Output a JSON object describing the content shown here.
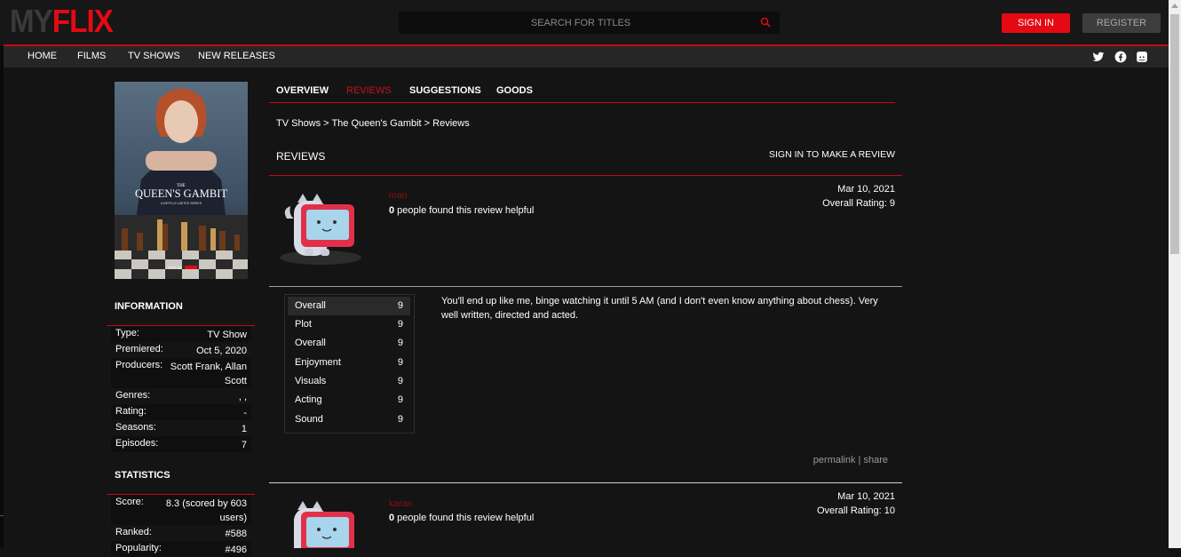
{
  "header": {
    "logo_my": "MY",
    "logo_flix": "FLIX",
    "search_placeholder": "SEARCH FOR TITLES",
    "sign_in": "SIGN IN",
    "register": "REGISTER"
  },
  "nav": {
    "items": [
      "HOME",
      "FILMS",
      "TV SHOWS",
      "NEW RELEASES"
    ],
    "social_icons": [
      "twitter-icon",
      "facebook-icon",
      "discord-icon"
    ]
  },
  "poster": {
    "title_small": "THE",
    "title": "QUEEN'S GAMBIT",
    "subtitle": "A NETFLIX LIMITED SERIES",
    "date": "OCT 23"
  },
  "information": {
    "title": "INFORMATION",
    "rows": [
      {
        "key": "Type:",
        "value": "TV Show"
      },
      {
        "key": "Premiered:",
        "value": "Oct 5, 2020"
      },
      {
        "key": "Producers:",
        "value": "Scott Frank, Allan Scott"
      },
      {
        "key": "Genres:",
        "value": ", ,"
      },
      {
        "key": "Rating:",
        "value": "-"
      },
      {
        "key": "Seasons:",
        "value": "1"
      },
      {
        "key": "Episodes:",
        "value": "7"
      }
    ]
  },
  "statistics": {
    "title": "STATISTICS",
    "rows": [
      {
        "key": "Score:",
        "value": "8.3 (scored by 603 users)"
      },
      {
        "key": "Ranked:",
        "value": "#588"
      },
      {
        "key": "Popularity:",
        "value": "#496"
      }
    ]
  },
  "tabs": [
    {
      "label": "OVERVIEW",
      "active": false
    },
    {
      "label": "REVIEWS",
      "active": true
    },
    {
      "label": "SUGGESTIONS",
      "active": false
    },
    {
      "label": "GOODS",
      "active": false
    }
  ],
  "breadcrumb": "TV Shows > The Queen's Gambit > Reviews",
  "reviews_section": {
    "title": "REVIEWS",
    "make_review": "SIGN IN TO MAKE A REVIEW"
  },
  "reviews": [
    {
      "username": "mari",
      "helpful_count": "0",
      "helpful_text": " people found this review helpful",
      "date": "Mar 10, 2021",
      "overall": "Overall Rating: 9",
      "ratings": [
        {
          "key": "Overall",
          "value": "9"
        },
        {
          "key": "Plot",
          "value": "9"
        },
        {
          "key": "Overall",
          "value": "9"
        },
        {
          "key": "Enjoyment",
          "value": "9"
        },
        {
          "key": "Visuals",
          "value": "9"
        },
        {
          "key": "Acting",
          "value": "9"
        },
        {
          "key": "Sound",
          "value": "9"
        }
      ],
      "text": "You'll end up like me, binge watching it until 5 AM (and I don't even know anything about chess). Very well written, directed and acted.",
      "permalink": "permalink",
      "share": "share",
      "divider": " | "
    },
    {
      "username": "karan",
      "helpful_count": "0",
      "helpful_text": " people found this review helpful",
      "date": "Mar 10, 2021",
      "overall": "Overall Rating: 10"
    }
  ],
  "colors": {
    "accent": "#e50914",
    "background": "#141414",
    "navbar": "#262626"
  }
}
